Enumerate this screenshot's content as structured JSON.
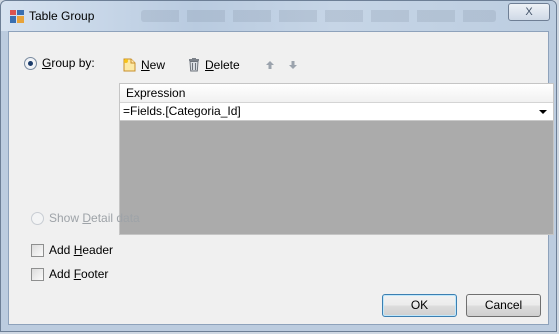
{
  "window": {
    "title": "Table Group",
    "close_glyph": "X"
  },
  "group_by": {
    "label_prefix": "",
    "label_mnemonic": "G",
    "label_rest": "roup by:",
    "selected": true
  },
  "toolbar": {
    "new_mnemonic": "N",
    "new_rest": "ew",
    "delete_mnemonic": "D",
    "delete_rest": "elete"
  },
  "grid": {
    "column_header": "Expression",
    "rows": [
      "=Fields.[Categoria_Id]"
    ]
  },
  "show_detail": {
    "prefix": "Show ",
    "mnemonic": "D",
    "rest": "etail data",
    "enabled": false
  },
  "add_header": {
    "prefix": "Add ",
    "mnemonic": "H",
    "rest": "eader",
    "checked": false
  },
  "add_footer": {
    "prefix": "Add ",
    "mnemonic": "F",
    "rest": "ooter",
    "checked": false
  },
  "buttons": {
    "ok": "OK",
    "cancel": "Cancel"
  },
  "colors": {
    "grid_empty": "#ababab",
    "title_bg": "#c6d5e6",
    "radio_dot": "#1b3b6a"
  }
}
